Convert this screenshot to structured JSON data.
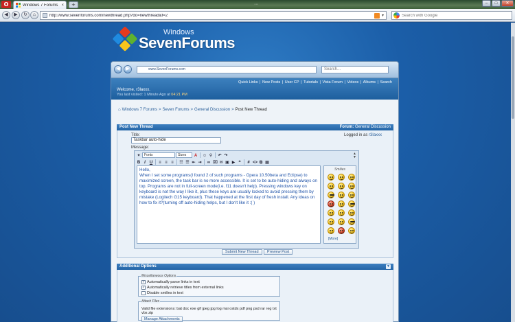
{
  "browser": {
    "tab_title": "Windows 7 Forums - P...",
    "tab_close": "×",
    "new_tab": "+",
    "grip": "⋯",
    "address": "http://www.sevenforums.com/newthread.php?do=newthread&f=2",
    "search_placeholder": "Search with Google",
    "window_controls": {
      "minimize": "–",
      "maximize": "□",
      "close": "✕"
    },
    "nav": {
      "back": "◀",
      "forward": "▶",
      "reload": "↻",
      "home": "⌂"
    }
  },
  "logo": {
    "line1": "Windows",
    "line2": "SevenForums"
  },
  "forum_nav": {
    "address": "www.SevenForums.com",
    "search_placeholder": "Search...",
    "back": "◀",
    "forward": "▶"
  },
  "header": {
    "links": [
      "Quick Links",
      "New Posts",
      "User CP",
      "Tutorials",
      "Vista Forum",
      "Videos",
      "Albums",
      "Search"
    ],
    "welcome": "Welcome, r3laxxx.",
    "visited": "You last visited: 1 Minute Ago at",
    "visited_time": "04:21 PM"
  },
  "breadcrumb": {
    "items": [
      "Windows 7 Forums",
      "Seven Forums",
      "General Discussion"
    ],
    "current": "Post New Thread",
    "separator": ">"
  },
  "post_panel": {
    "title": "Post New Thread",
    "forum_label": "Forum:",
    "forum_name": "General Discussion",
    "title_label": "Title:",
    "title_value": "Taskbar auto-hide",
    "message_label": "Message:",
    "logged_label": "Logged in as",
    "logged_user": "r3laxxx"
  },
  "editor": {
    "font_select": "Fonts",
    "size_select": "Sizes",
    "message_lines": [
      "Hello,",
      "When I set some programs(I found 2 of such programs - Opera 10.50beta and Eclipse) to maximized screen, the task bar is no more accessible. It is set to be auto-hiding and always on top. Programs are not in full-screen mode(i.e. f11 doesn't help). Pressing windows key on keyboard is not the way I like it, plus these keys are usually locked to avoid pressing them by mistake (Logitech G15 keyboard). That happened at the first day of fresh install. Any ideas on how to fix it?(turning off auto-hiding helps, but I don't like it :( )"
    ],
    "smilies_title": "Smilies",
    "smilies_more": "[More]"
  },
  "buttons": {
    "submit": "Submit New Thread",
    "preview": "Preview Post"
  },
  "additional": {
    "title": "Additional Options",
    "misc_legend": "Miscellaneous Options",
    "options": [
      {
        "label": "Automatically parse links in text",
        "checked": true
      },
      {
        "label": "Automatically retrieve titles from external links",
        "checked": true
      },
      {
        "label": "Disable smilies in text",
        "checked": false
      }
    ],
    "attach_legend": "Attach Files",
    "attach_text": "Valid file extensions: bat doc exe gif jpeg jpg log msi ostdx pdf png psd rar reg txt vbs zip",
    "manage_button": "Manage Attachments"
  }
}
